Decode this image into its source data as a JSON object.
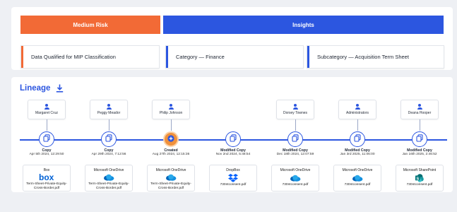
{
  "risk": {
    "label": "Medium Risk",
    "color": "#f26a36"
  },
  "insights": {
    "label": "Insights",
    "color": "#2c56e0"
  },
  "tags": [
    {
      "label": "Data Qualified for MIP Classification",
      "accent": "#f26a36"
    },
    {
      "label": "Category — Finance",
      "accent": "#2c56e0"
    },
    {
      "label": "Subcategory — Acquisition Term Sheet",
      "accent": "#2c56e0"
    }
  ],
  "lineage": {
    "title": "Lineage",
    "download_icon": "download-icon",
    "nodes": [
      {
        "user": "Margaret Cruz",
        "action": "Copy",
        "timestamp": "Apr 5th 2024, 12:29:50",
        "source": "Box",
        "logo": "box-logo",
        "file": "Term-Sheet-Private-Equity-Cross-Border.pdf",
        "icon": "copy-icon"
      },
      {
        "user": "Peggy Meador",
        "action": "Copy",
        "timestamp": "Apr 29th 2024, 7:12:56",
        "source": "Microsoft OneDrive",
        "logo": "onedrive-logo",
        "file": "Term-Sheet-Private-Equity-Cross-Border.pdf",
        "icon": "copy-icon"
      },
      {
        "user": "Philip Johnson",
        "action": "Created",
        "timestamp": "Aug 27th 2024, 12:15:36",
        "source": "Microsoft OneDrive",
        "logo": "onedrive-logo",
        "file": "Term-Sheet-Private-Equity-Cross-Border.pdf",
        "icon": "plus-icon"
      },
      {
        "user": "",
        "action": "Modified Copy",
        "timestamp": "Nov 2nd 2024, 5:48:54",
        "source": "DropBox",
        "logo": "dropbox-logo",
        "file": "730ntconsent.pdf",
        "icon": "copy-icon"
      },
      {
        "user": "Dorsey Townes",
        "action": "Modified Copy",
        "timestamp": "Dec 18th 2024, 12:07:59",
        "source": "Microsoft OneDrive",
        "logo": "onedrive-logo",
        "file": "730ntconsent.pdf",
        "icon": "copy-icon"
      },
      {
        "user": "Administrators",
        "action": "Modified Copy",
        "timestamp": "Jan 3rd 2025, 11:06:00",
        "source": "Microsoft OneDrive",
        "logo": "onedrive-logo",
        "file": "730ntconsent.pdf",
        "icon": "copy-icon"
      },
      {
        "user": "Deana Hooper",
        "action": "Modified Copy",
        "timestamp": "Jan 16th 2025, 2:46:52",
        "source": "Microsoft SharePoint",
        "logo": "sharepoint-logo",
        "file": "730ntconsent.pdf",
        "icon": "copy-icon"
      }
    ]
  }
}
